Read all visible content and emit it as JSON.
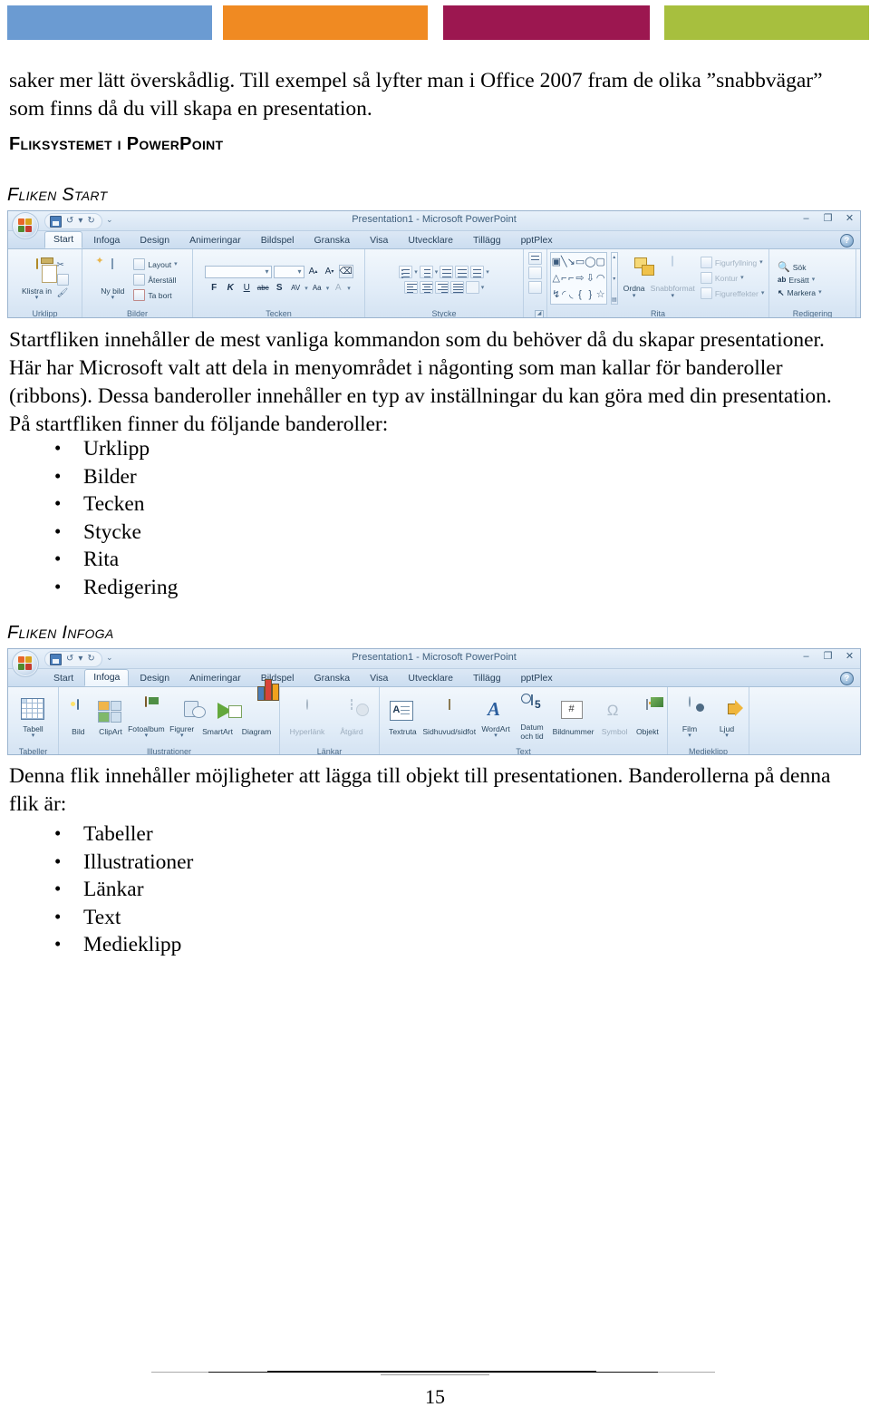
{
  "colorbars": [
    {
      "name": "blue",
      "color": "#6b9bd2"
    },
    {
      "name": "orange",
      "color": "#f08a22"
    },
    {
      "name": "maroon",
      "color": "#9c1750"
    },
    {
      "name": "green",
      "color": "#a7bf3e"
    }
  ],
  "document": {
    "intro_paragraph": "saker mer lätt överskådlig.  Till exempel så lyfter man i Office 2007 fram de olika ”snabbvägar” som finns då du vill skapa en presentation.",
    "h1": "Fliksystemet i PowerPoint",
    "section_start": {
      "heading": "Fliken Start",
      "paragraph": "Startfliken innehåller de mest vanliga kommandon som du behöver då du skapar presentationer. Här har Microsoft valt att dela in menyområdet i någonting som man kallar för banderoller (ribbons). Dessa banderoller innehåller en typ av inställningar du kan göra med din presentation. På startfliken finner du följande banderoller:",
      "bullets": [
        "Urklipp",
        "Bilder",
        "Tecken",
        "Stycke",
        "Rita",
        "Redigering"
      ]
    },
    "section_infoga": {
      "heading": "Fliken Infoga",
      "paragraph": "Denna flik innehåller möjligheter att lägga till objekt till presentationen. Banderollerna på denna flik är:",
      "bullets": [
        "Tabeller",
        "Illustrationer",
        "Länkar",
        "Text",
        "Medieklipp"
      ]
    },
    "page_number": "15"
  },
  "ribbon_start": {
    "title": "Presentation1 - Microsoft PowerPoint",
    "window_controls": [
      "–",
      "❐",
      "✕"
    ],
    "help_glyph": "?",
    "quick_access": [
      "save-icon",
      "undo-icon",
      "redo-icon",
      "customize-icon"
    ],
    "tabs": [
      "Start",
      "Infoga",
      "Design",
      "Animeringar",
      "Bildspel",
      "Granska",
      "Visa",
      "Utvecklare",
      "Tillägg",
      "pptPlex"
    ],
    "active_tab": "Start",
    "groups": [
      {
        "label": "Urklipp",
        "big_buttons": [
          {
            "label": "Klistra in",
            "caret": "▾",
            "icon": "clipboard-icon"
          }
        ],
        "small_buttons": [
          {
            "label": "",
            "icon": "scissors-icon"
          },
          {
            "label": "",
            "icon": "copy-icon"
          },
          {
            "label": "",
            "icon": "format-painter-icon"
          }
        ],
        "has_dialog_launcher": true
      },
      {
        "label": "Bilder",
        "big_buttons": [
          {
            "label": "Ny bild",
            "caret": "▾",
            "icon": "new-slide-icon"
          }
        ],
        "small_buttons": [
          {
            "label": "Layout",
            "icon": "layout-icon",
            "caret": "▾"
          },
          {
            "label": "Återställ",
            "icon": "reset-icon"
          },
          {
            "label": "Ta bort",
            "icon": "delete-icon"
          }
        ],
        "has_dialog_launcher": false
      },
      {
        "label": "Tecken",
        "font_name_value": "",
        "font_size_value": "",
        "buttons_row1": [
          "A⁺",
          "A⁻",
          "Aa-clear"
        ],
        "buttons_row2": [
          "F",
          "K",
          "U",
          "abc",
          "S",
          "AV",
          "Aa",
          "A"
        ],
        "has_dialog_launcher": true
      },
      {
        "label": "Stycke",
        "buttons_row1": [
          "bullets",
          "numbering",
          "decrease-indent",
          "increase-indent",
          "line-spacing",
          "text-direction"
        ],
        "buttons_row2": [
          "align-left",
          "align-center",
          "align-right",
          "justify",
          "columns",
          "align-text",
          "smartart"
        ],
        "has_dialog_launcher": true
      },
      {
        "label": "Rita",
        "shapes": [
          "▣",
          "╲",
          "➘",
          "▭",
          "◯",
          "▢",
          "△",
          "⌐",
          "⌐",
          "⇨",
          "⇩",
          "◠",
          "↯",
          "◜",
          "◟",
          "{",
          "}",
          "☆"
        ],
        "big_buttons": [
          {
            "label": "Ordna",
            "caret": "▾",
            "icon": "arrange-icon"
          },
          {
            "label": "Snabbformat",
            "caret": "▾",
            "icon": "quick-style-icon"
          }
        ],
        "small_buttons": [
          {
            "label": "Figurfyllning",
            "icon": "shape-fill-icon",
            "caret": "▾"
          },
          {
            "label": "Kontur",
            "icon": "shape-outline-icon",
            "caret": "▾"
          },
          {
            "label": "Figureffekter",
            "icon": "shape-effects-icon",
            "caret": "▾"
          }
        ],
        "has_dialog_launcher": true
      },
      {
        "label": "Redigering",
        "small_buttons": [
          {
            "label": "Sök",
            "icon": "find-icon"
          },
          {
            "label": "Ersätt",
            "icon": "replace-icon",
            "caret": "▾"
          },
          {
            "label": "Markera",
            "icon": "select-icon",
            "caret": "▾"
          }
        ],
        "has_dialog_launcher": false
      }
    ]
  },
  "ribbon_infoga": {
    "title": "Presentation1 - Microsoft PowerPoint",
    "window_controls": [
      "–",
      "❐",
      "✕"
    ],
    "help_glyph": "?",
    "tabs": [
      "Start",
      "Infoga",
      "Design",
      "Animeringar",
      "Bildspel",
      "Granska",
      "Visa",
      "Utvecklare",
      "Tillägg",
      "pptPlex"
    ],
    "active_tab": "Infoga",
    "groups": [
      {
        "label": "Tabeller",
        "buttons": [
          {
            "label": "Tabell",
            "caret": "▾",
            "icon": "table-icon"
          }
        ]
      },
      {
        "label": "Illustrationer",
        "buttons": [
          {
            "label": "Bild",
            "icon": "picture-icon"
          },
          {
            "label": "ClipArt",
            "icon": "clipart-icon"
          },
          {
            "label": "Fotoalbum",
            "caret": "▾",
            "icon": "photo-album-icon"
          },
          {
            "label": "Figurer",
            "caret": "▾",
            "icon": "shapes-icon"
          },
          {
            "label": "SmartArt",
            "icon": "smartart-icon"
          },
          {
            "label": "Diagram",
            "icon": "chart-icon"
          }
        ]
      },
      {
        "label": "Länkar",
        "buttons": [
          {
            "label": "Hyperlänk",
            "icon": "hyperlink-icon",
            "disabled": true
          },
          {
            "label": "Åtgärd",
            "icon": "action-icon",
            "disabled": true
          }
        ]
      },
      {
        "label": "Text",
        "buttons": [
          {
            "label": "Textruta",
            "icon": "textbox-icon"
          },
          {
            "label": "Sidhuvud/sidfot",
            "icon": "header-footer-icon"
          },
          {
            "label": "WordArt",
            "caret": "▾",
            "icon": "wordart-icon"
          },
          {
            "label": "Datum och tid",
            "icon": "date-time-icon"
          },
          {
            "label": "Bildnummer",
            "icon": "slide-number-icon"
          },
          {
            "label": "Symbol",
            "icon": "symbol-icon",
            "disabled": true
          },
          {
            "label": "Objekt",
            "icon": "object-icon"
          }
        ]
      },
      {
        "label": "Medieklipp",
        "buttons": [
          {
            "label": "Film",
            "caret": "▾",
            "icon": "film-icon"
          },
          {
            "label": "Ljud",
            "caret": "▾",
            "icon": "sound-icon"
          }
        ]
      }
    ]
  }
}
